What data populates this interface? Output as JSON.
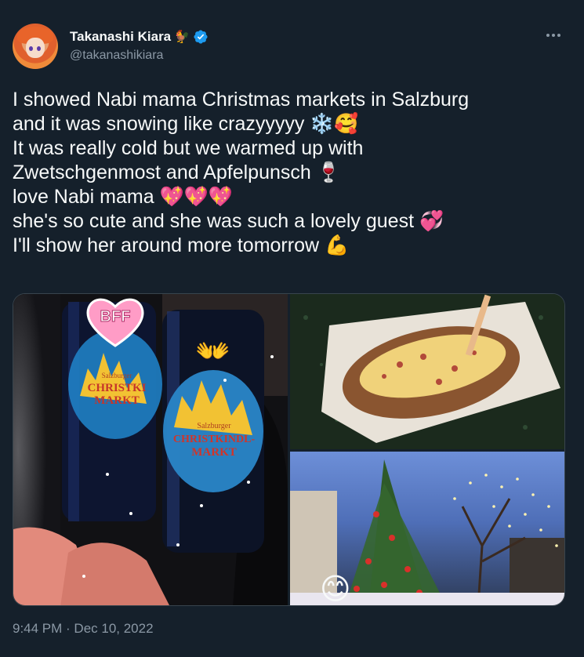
{
  "author": {
    "display_name": "Takanashi Kiara",
    "name_emoji": "🐓",
    "handle": "@takanashikiara",
    "verified": true
  },
  "tweet": {
    "lines": [
      "I showed Nabi mama Christmas markets in Salzburg",
      "and it was snowing like crazyyyyy ❄️🥰",
      "It was really cold but we warmed up with",
      "Zwetschgenmost and Apfelpunsch 🍷",
      "love Nabi mama 💖💖💖",
      "she's so cute and she was such a lovely guest 💞",
      "I'll show her around more tomorrow 💪"
    ]
  },
  "media": {
    "sticker_text": "BFF",
    "mug_left_text": [
      "Salzburger",
      "CHRISTKI",
      "MARKT"
    ],
    "mug_right_text": [
      "Salzburger",
      "CHRISTKINDL-",
      "MARKT"
    ],
    "hands_emoji": "👐",
    "smile_emoji": "😊"
  },
  "footer": {
    "timestamp": "9:44 PM · Dec 10, 2022"
  },
  "colors": {
    "background": "#15202b",
    "text": "#f7f9f9",
    "secondary": "#8b98a5",
    "verified": "#1d9bf0"
  }
}
